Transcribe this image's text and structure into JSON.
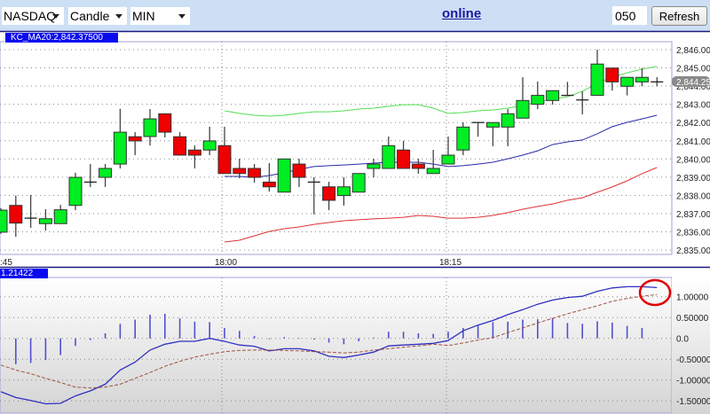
{
  "toolbar": {
    "exchange": "NASDAQ",
    "chart_type": "Candle",
    "interval": "MIN",
    "status_link": "online",
    "count_value": "050",
    "refresh_label": "Refresh"
  },
  "main_panel": {
    "indicator_label": "KC_MA20:2,842.37500",
    "price_labels": [
      "2,846.00",
      "2,845.00",
      "2,844.00",
      "2,843.00",
      "2,842.00",
      "2,841.00",
      "2,840.00",
      "2,839.00",
      "2,838.00",
      "2,837.00",
      "2,836.00",
      "2,835.00"
    ],
    "current_price": "2,844.25",
    "time_labels": [
      ":45",
      "18:00",
      "18:15"
    ]
  },
  "lower_panel": {
    "indicator_label": "1.21422",
    "value_labels": [
      "1.00000",
      "0.50000",
      "0.0",
      "-0.50000",
      "-1.00000",
      "-1.50000"
    ]
  },
  "colors": {
    "up": "#00ee22",
    "down": "#ee0000",
    "upper_band": "#55dd55",
    "middle_band": "#2a2aa8",
    "lower_band": "#dd3333",
    "macd": "#3030c0",
    "signal": "#a05040",
    "histogram": "#5050d0",
    "annotation": "#e00000",
    "accent": "#0a0af0"
  },
  "chart_data": [
    {
      "type": "candlestick",
      "title": "KC_MA20:2,842.37500",
      "ylim": [
        2835,
        2846
      ],
      "candles": [
        {
          "o": 2835.98,
          "h": 2837.3,
          "l": 2835.9,
          "c": 2837.19
        },
        {
          "o": 2837.45,
          "h": 2837.99,
          "l": 2835.73,
          "c": 2836.48
        },
        {
          "o": 2836.75,
          "h": 2838.02,
          "l": 2836.22,
          "c": 2836.75
        },
        {
          "o": 2836.45,
          "h": 2837.24,
          "l": 2836.07,
          "c": 2836.72
        },
        {
          "o": 2836.45,
          "h": 2837.48,
          "l": 2836.45,
          "c": 2837.21
        },
        {
          "o": 2837.45,
          "h": 2839.24,
          "l": 2837.19,
          "c": 2838.99
        },
        {
          "o": 2838.73,
          "h": 2839.72,
          "l": 2838.46,
          "c": 2838.73
        },
        {
          "o": 2838.99,
          "h": 2839.72,
          "l": 2838.46,
          "c": 2839.48
        },
        {
          "o": 2839.72,
          "h": 2842.75,
          "l": 2839.48,
          "c": 2841.47
        },
        {
          "o": 2841.22,
          "h": 2841.47,
          "l": 2840.21,
          "c": 2840.99
        },
        {
          "o": 2841.23,
          "h": 2842.74,
          "l": 2840.74,
          "c": 2842.2
        },
        {
          "o": 2842.48,
          "h": 2842.48,
          "l": 2841.18,
          "c": 2841.47
        },
        {
          "o": 2841.22,
          "h": 2841.47,
          "l": 2840.21,
          "c": 2840.21
        },
        {
          "o": 2840.49,
          "h": 2840.74,
          "l": 2839.48,
          "c": 2840.21
        },
        {
          "o": 2840.49,
          "h": 2841.77,
          "l": 2840.21,
          "c": 2840.99
        },
        {
          "o": 2840.73,
          "h": 2841.77,
          "l": 2839.2,
          "c": 2839.2
        },
        {
          "o": 2839.48,
          "h": 2840.01,
          "l": 2838.94,
          "c": 2839.2
        },
        {
          "o": 2839.48,
          "h": 2839.72,
          "l": 2838.7,
          "c": 2838.99
        },
        {
          "o": 2838.73,
          "h": 2839.77,
          "l": 2838.21,
          "c": 2838.47
        },
        {
          "o": 2838.18,
          "h": 2840.0,
          "l": 2838.18,
          "c": 2840.0
        },
        {
          "o": 2839.72,
          "h": 2840.01,
          "l": 2838.46,
          "c": 2838.99
        },
        {
          "o": 2838.73,
          "h": 2838.99,
          "l": 2836.96,
          "c": 2838.73
        },
        {
          "o": 2838.47,
          "h": 2838.75,
          "l": 2837.19,
          "c": 2837.73
        },
        {
          "o": 2837.99,
          "h": 2838.99,
          "l": 2837.44,
          "c": 2838.47
        },
        {
          "o": 2838.18,
          "h": 2839.2,
          "l": 2838.18,
          "c": 2839.2
        },
        {
          "o": 2839.48,
          "h": 2840.01,
          "l": 2838.99,
          "c": 2839.72
        },
        {
          "o": 2839.48,
          "h": 2841.23,
          "l": 2839.48,
          "c": 2840.73
        },
        {
          "o": 2840.49,
          "h": 2840.99,
          "l": 2839.48,
          "c": 2839.48
        },
        {
          "o": 2839.72,
          "h": 2840.01,
          "l": 2839.19,
          "c": 2839.48
        },
        {
          "o": 2839.2,
          "h": 2840.5,
          "l": 2839.2,
          "c": 2839.48
        },
        {
          "o": 2839.72,
          "h": 2841.23,
          "l": 2839.72,
          "c": 2840.21
        },
        {
          "o": 2840.49,
          "h": 2842.01,
          "l": 2840.21,
          "c": 2841.75
        },
        {
          "o": 2842.0,
          "h": 2842.0,
          "l": 2841.22,
          "c": 2842.0
        },
        {
          "o": 2841.75,
          "h": 2842.0,
          "l": 2840.7,
          "c": 2842.0
        },
        {
          "o": 2841.75,
          "h": 2842.74,
          "l": 2840.7,
          "c": 2842.48
        },
        {
          "o": 2842.24,
          "h": 2844.49,
          "l": 2842.24,
          "c": 2843.21
        },
        {
          "o": 2843.0,
          "h": 2844.25,
          "l": 2842.74,
          "c": 2843.49
        },
        {
          "o": 2843.21,
          "h": 2843.75,
          "l": 2842.98,
          "c": 2843.75
        },
        {
          "o": 2843.49,
          "h": 2844.23,
          "l": 2843.49,
          "c": 2843.49
        },
        {
          "o": 2843.24,
          "h": 2843.71,
          "l": 2842.45,
          "c": 2843.24
        },
        {
          "o": 2843.49,
          "h": 2846.0,
          "l": 2843.49,
          "c": 2845.21
        },
        {
          "o": 2844.99,
          "h": 2844.99,
          "l": 2843.75,
          "c": 2844.23
        },
        {
          "o": 2843.99,
          "h": 2844.48,
          "l": 2843.49,
          "c": 2844.48
        },
        {
          "o": 2844.23,
          "h": 2844.99,
          "l": 2843.99,
          "c": 2844.48
        },
        {
          "o": 2844.23,
          "h": 2844.49,
          "l": 2843.99,
          "c": 2844.23
        }
      ],
      "series": [
        {
          "name": "upper",
          "start": 15,
          "values": [
            2842.64,
            2842.5,
            2842.4,
            2842.35,
            2842.4,
            2842.5,
            2842.59,
            2842.59,
            2842.64,
            2842.74,
            2842.79,
            2842.89,
            2842.98,
            2842.98,
            2842.79,
            2842.5,
            2842.55,
            2842.64,
            2842.69,
            2842.79,
            2842.93,
            2843.13,
            2843.27,
            2843.42,
            2843.71,
            2844.15,
            2844.49,
            2844.73,
            2844.93,
            2845.08
          ]
        },
        {
          "name": "middle",
          "start": 15,
          "values": [
            2839.04,
            2839.04,
            2838.99,
            2839.09,
            2839.24,
            2839.43,
            2839.58,
            2839.63,
            2839.67,
            2839.72,
            2839.77,
            2839.82,
            2839.82,
            2839.82,
            2839.72,
            2839.58,
            2839.63,
            2839.72,
            2839.82,
            2840.01,
            2840.21,
            2840.45,
            2840.79,
            2840.94,
            2841.04,
            2841.38,
            2841.77,
            2842.01,
            2842.2,
            2842.4
          ]
        },
        {
          "name": "lower",
          "start": 15,
          "values": [
            2835.44,
            2835.54,
            2835.78,
            2836.02,
            2836.17,
            2836.27,
            2836.41,
            2836.51,
            2836.61,
            2836.66,
            2836.71,
            2836.75,
            2836.8,
            2836.9,
            2836.85,
            2836.75,
            2836.75,
            2836.8,
            2836.9,
            2837.05,
            2837.24,
            2837.39,
            2837.53,
            2837.73,
            2837.87,
            2838.17,
            2838.46,
            2838.8,
            2839.19,
            2839.53
          ]
        }
      ],
      "current_price": 2844.25
    },
    {
      "type": "line",
      "title": "1.21422",
      "ylim": [
        -1.6,
        1.3
      ],
      "series": [
        {
          "name": "macd",
          "start": 0,
          "values": [
            -1.28,
            -1.42,
            -1.49,
            -1.57,
            -1.56,
            -1.38,
            -1.26,
            -1.1,
            -0.76,
            -0.57,
            -0.28,
            -0.14,
            -0.07,
            -0.07,
            0.0,
            -0.07,
            -0.16,
            -0.19,
            -0.3,
            -0.25,
            -0.25,
            -0.3,
            -0.43,
            -0.46,
            -0.4,
            -0.33,
            -0.18,
            -0.16,
            -0.14,
            -0.12,
            -0.05,
            0.18,
            0.32,
            0.43,
            0.57,
            0.69,
            0.82,
            0.92,
            0.98,
            1.01,
            1.13,
            1.21,
            1.24,
            1.24,
            1.22
          ]
        },
        {
          "name": "signal",
          "start": 0,
          "values": [
            -0.64,
            -0.76,
            -0.85,
            -0.96,
            -1.06,
            -1.17,
            -1.19,
            -1.17,
            -1.1,
            -0.96,
            -0.82,
            -0.67,
            -0.55,
            -0.45,
            -0.38,
            -0.32,
            -0.29,
            -0.28,
            -0.28,
            -0.29,
            -0.3,
            -0.32,
            -0.33,
            -0.35,
            -0.33,
            -0.28,
            -0.25,
            -0.21,
            -0.18,
            -0.14,
            -0.17,
            -0.11,
            -0.04,
            0.02,
            0.14,
            0.25,
            0.37,
            0.48,
            0.59,
            0.69,
            0.78,
            0.89,
            0.96,
            1.01,
            1.05
          ]
        },
        {
          "name": "histogram",
          "start": 1,
          "values": [
            -0.62,
            -0.59,
            -0.52,
            -0.4,
            -0.18,
            -0.04,
            0.12,
            0.35,
            0.45,
            0.57,
            0.59,
            0.48,
            0.4,
            0.39,
            0.25,
            0.18,
            0.06,
            -0.02,
            0.03,
            0.01,
            -0.03,
            -0.1,
            -0.14,
            -0.07,
            0.02,
            0.16,
            0.16,
            0.12,
            0.11,
            0.16,
            0.25,
            0.32,
            0.39,
            0.4,
            0.45,
            0.46,
            0.48,
            0.37,
            0.35,
            0.41,
            0.38,
            0.3,
            0.25
          ]
        }
      ]
    }
  ]
}
